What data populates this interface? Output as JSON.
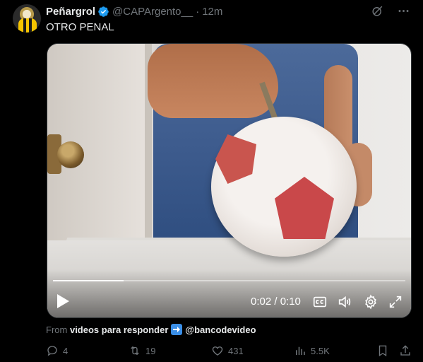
{
  "tweet": {
    "author_name": "Peñargrol",
    "handle": "@CAPArgento__",
    "separator": "·",
    "time": "12m",
    "text": "OTRO PENAL"
  },
  "video": {
    "current_time": "0:02",
    "duration": "0:10",
    "time_display": "0:02 / 0:10",
    "progress_fraction": 0.2,
    "from_prefix": "From",
    "from_source": "videos para responder",
    "from_handle": "@bancodevideo"
  },
  "actions": {
    "replies": "4",
    "reposts": "19",
    "likes": "431",
    "views": "5.5K"
  },
  "colors": {
    "background": "#000000",
    "text_primary": "#e7e9ea",
    "text_secondary": "#71767b",
    "verified_blue": "#1d9bf0"
  }
}
